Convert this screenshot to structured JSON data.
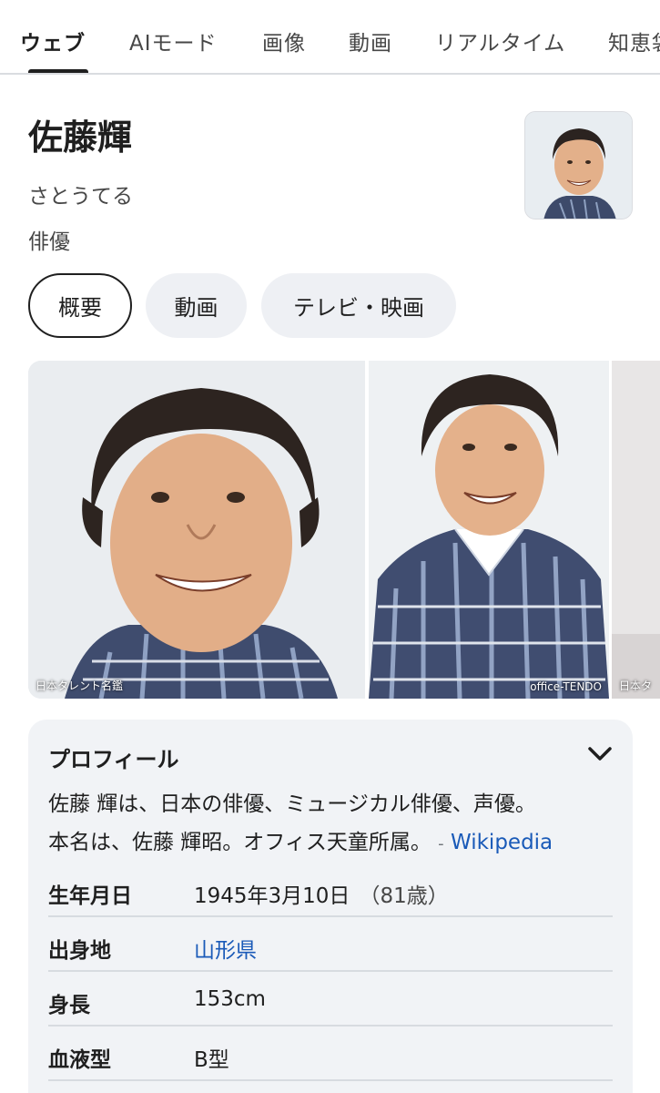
{
  "tabs": [
    "ウェブ",
    "AIモード",
    "画像",
    "動画",
    "リアルタイム",
    "知恵袋"
  ],
  "entity": {
    "name": "佐藤輝",
    "reading": "さとうてる",
    "occupation": "俳優"
  },
  "chips": [
    "概要",
    "動画",
    "テレビ・映画"
  ],
  "images": [
    {
      "credit": "日本タレント名鑑"
    },
    {
      "credit": "office-TENDO"
    },
    {
      "credit": "日本タ"
    }
  ],
  "profile": {
    "title": "プロフィール",
    "description_line1": "佐藤 輝は、日本の俳優、ミュージカル俳優、声優。",
    "description_line2": "本名は、佐藤 輝昭。オフィス天童所属。",
    "source_dash": "-",
    "source": "Wikipedia",
    "rows": [
      {
        "label": "生年月日",
        "value": "1945年3月10日",
        "extra": "（81歳）"
      },
      {
        "label": "出身地",
        "value": "山形県"
      },
      {
        "label": "身長",
        "value": "153cm"
      },
      {
        "label": "血液型",
        "value": "B型"
      }
    ]
  },
  "colors": {
    "link": "#1a5ab8",
    "card_bg": "#f1f3f6",
    "chip_bg": "#eef0f4"
  }
}
